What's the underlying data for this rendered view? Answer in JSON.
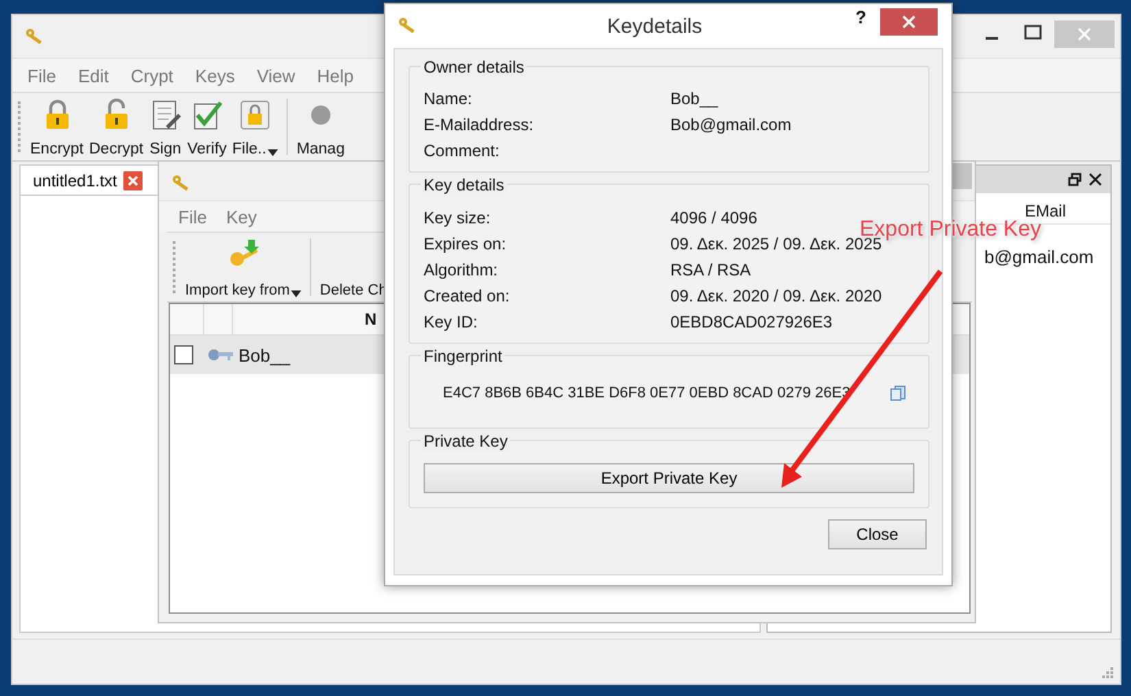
{
  "main_window": {
    "menu": [
      "File",
      "Edit",
      "Crypt",
      "Keys",
      "View",
      "Help"
    ],
    "toolbar": [
      {
        "label": "Encrypt",
        "kind": "lock-closed",
        "dropdown": false
      },
      {
        "label": "Decrypt",
        "kind": "lock-open",
        "dropdown": false
      },
      {
        "label": "Sign",
        "kind": "document",
        "dropdown": false
      },
      {
        "label": "Verify",
        "kind": "check",
        "dropdown": false
      },
      {
        "label": "File..",
        "kind": "file-lock",
        "dropdown": true
      },
      {
        "label": "Manag",
        "kind": "manage",
        "dropdown": false
      }
    ],
    "tab": {
      "label": "untitled1.txt"
    },
    "dock": {
      "column": "EMail",
      "cell": "b@gmail.com"
    }
  },
  "key_manager": {
    "menu": [
      "File",
      "Key"
    ],
    "toolbar": [
      {
        "label": "Import key from",
        "kind": "import",
        "dropdown": true
      },
      {
        "label": "Delete Ch",
        "kind": "none"
      }
    ],
    "columns": [
      "N"
    ],
    "rows": [
      {
        "name": "Bob__",
        "checked": false,
        "selected": true
      }
    ]
  },
  "dialog": {
    "title": "Keydetails",
    "help": "?",
    "groups": [
      {
        "title": "Owner details",
        "kind": "fields",
        "fields": [
          {
            "label": "Name:",
            "value": "Bob__"
          },
          {
            "label": "E-Mailaddress:",
            "value": "Bob@gmail.com"
          },
          {
            "label": "Comment:"
          }
        ]
      },
      {
        "title": "Key details",
        "kind": "fields",
        "fields": [
          {
            "label": "Key size:",
            "value": "4096 / 4096"
          },
          {
            "label": "Expires on:",
            "value": "09. Δεκ. 2025 / 09. Δεκ. 2025"
          },
          {
            "label": "Algorithm:",
            "value": "RSA / RSA"
          },
          {
            "label": "Created on:",
            "value": "09. Δεκ. 2020 / 09. Δεκ. 2020"
          },
          {
            "label": "Key ID:",
            "value": "0EBD8CAD027926E3"
          }
        ]
      },
      {
        "title": "Fingerprint",
        "kind": "fingerprint",
        "value": "E4C7 8B6B 6B4C 31BE D6F8 0E77 0EBD 8CAD 0279 26E3"
      },
      {
        "title": "Private Key",
        "kind": "button",
        "button": "Export Private Key"
      }
    ],
    "close": "Close"
  },
  "annotation": {
    "text": "Export Private Key"
  }
}
